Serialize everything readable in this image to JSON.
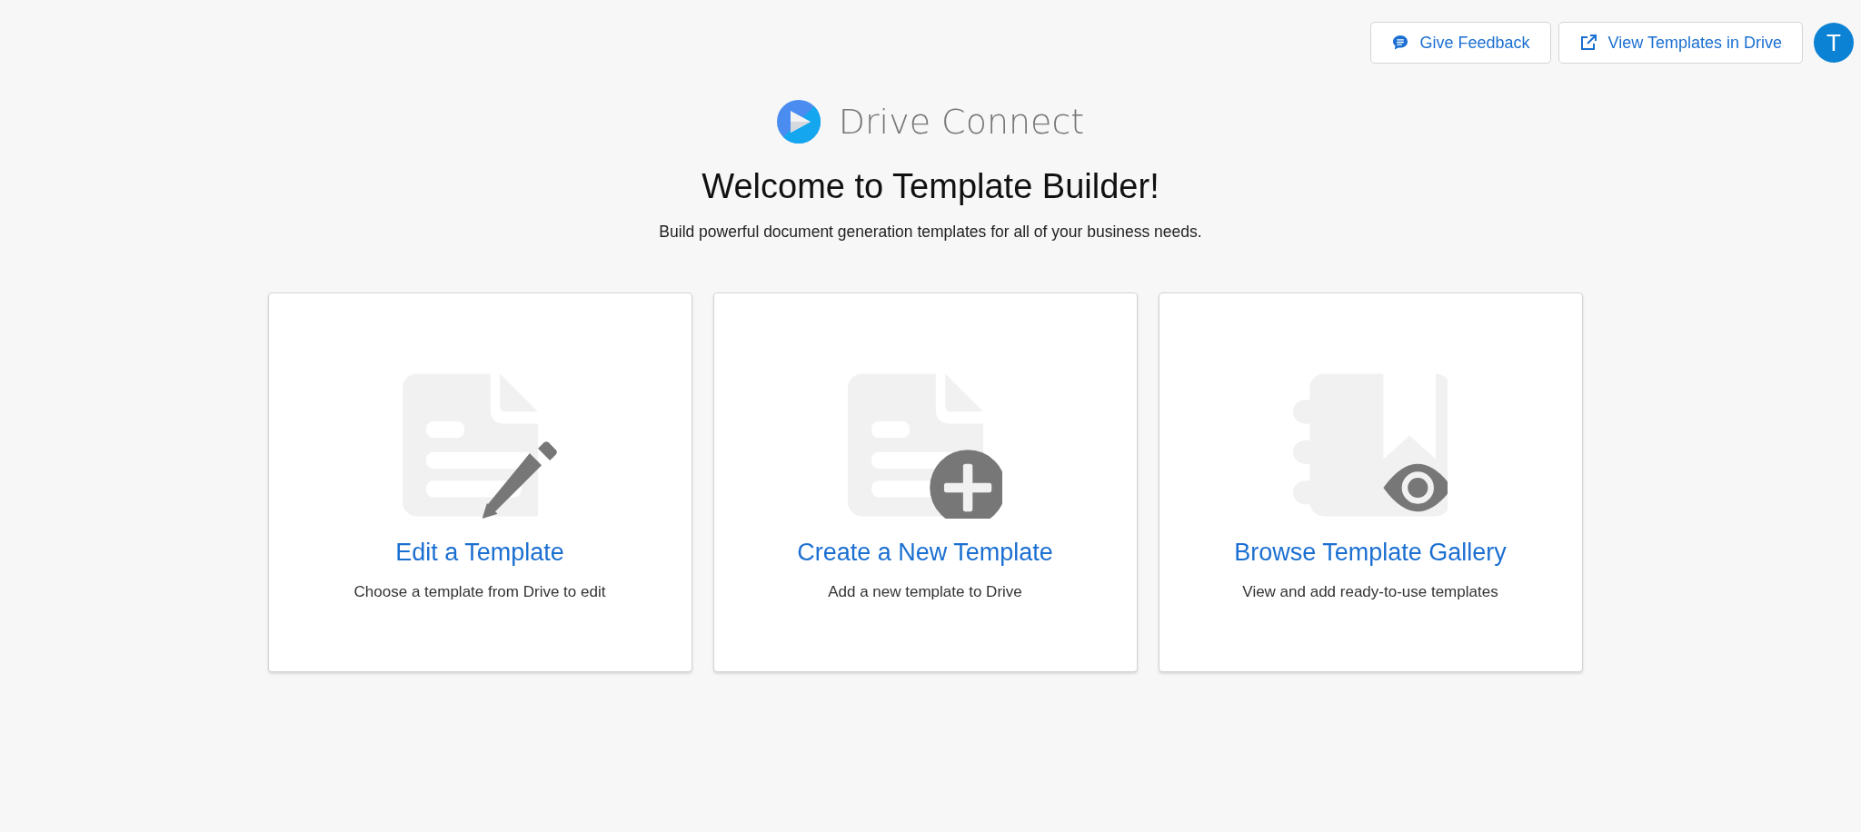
{
  "header_buttons": [
    {
      "kind": "feedback",
      "label": "Give Feedback"
    },
    {
      "kind": "external",
      "label": "View Templates in Drive"
    }
  ],
  "avatar": {
    "initial": "T"
  },
  "logo": {
    "name": "Drive Connect"
  },
  "title": "Welcome to Template Builder!",
  "subtitle": "Build powerful document generation templates for all of your business needs.",
  "cards": [
    {
      "kind": "edit",
      "title": "Edit a Template",
      "description": "Choose a template from Drive to edit"
    },
    {
      "kind": "create",
      "title": "Create a New Template",
      "description": "Add a new template to Drive"
    },
    {
      "kind": "browse",
      "title": "Browse Template Gallery",
      "description": "View and add ready-to-use templates"
    }
  ]
}
